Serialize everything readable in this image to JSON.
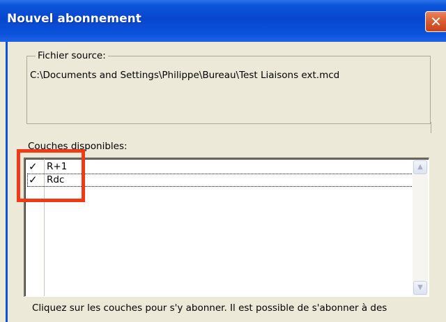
{
  "window": {
    "title": "Nouvel abonnement",
    "close_glyph": "✕"
  },
  "source_group": {
    "legend": "Fichier source:",
    "path": "C:\\Documents and Settings\\Philippe\\Bureau\\Test Liaisons ext.mcd"
  },
  "layers": {
    "label": "Couches disponibles:",
    "items": [
      {
        "label": "R+1",
        "checked": true,
        "check_glyph": "✓"
      },
      {
        "label": "Rdc",
        "checked": true,
        "check_glyph": "✓",
        "focused": true
      }
    ],
    "scroll_up_glyph": "▲",
    "scroll_down_glyph": "▼"
  },
  "instructions": "Cliquez sur les couches pour s'y abonner.  Il est possible de s'abonner à des",
  "colors": {
    "titlebar": "#0A52DB",
    "dialog_bg": "#ECE9D8",
    "highlight": "#F03A17",
    "close_button": "#D95B30"
  }
}
